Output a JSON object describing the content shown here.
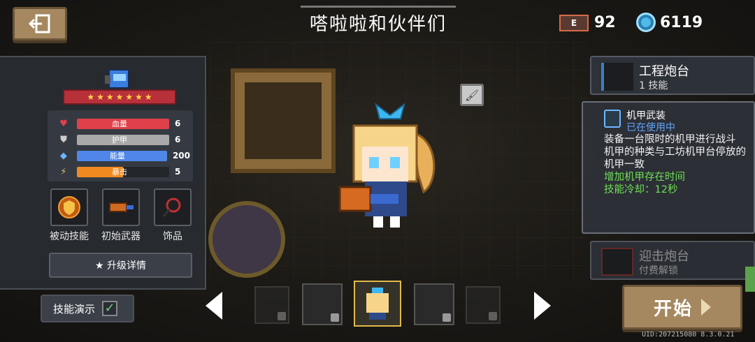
{
  "header": {
    "title": "嗒啦啦和伙伴们",
    "gem_label": "E",
    "gem_count": "92",
    "coin_count": "6119"
  },
  "hero": {
    "stars": 7,
    "stats": [
      {
        "name": "血量",
        "value": "6",
        "fill": 1.0,
        "color": "#e0404a",
        "icon": "heart-icon"
      },
      {
        "name": "护甲",
        "value": "6",
        "fill": 1.0,
        "color": "#a9a9a9",
        "icon": "shield-icon"
      },
      {
        "name": "能量",
        "value": "200",
        "fill": 1.0,
        "color": "#4f86e8",
        "icon": "energy-crystal-icon"
      },
      {
        "name": "暴击",
        "value": "5",
        "fill": 0.5,
        "color": "#f08a20",
        "icon": "crit-icon"
      }
    ],
    "slots": [
      {
        "label": "被动技能",
        "icon": "passive-skill-icon"
      },
      {
        "label": "初始武器",
        "icon": "starting-weapon-icon"
      },
      {
        "label": "饰品",
        "icon": "accessory-icon"
      }
    ],
    "upgrade_label": "★ 升级详情",
    "demo_label": "技能演示",
    "demo_checked": true
  },
  "skills": {
    "current": {
      "name": "工程炮台",
      "count": "1 技能"
    },
    "tooltip": {
      "title": "机甲武装",
      "status": "已在使用中",
      "lines": [
        "装备一台限时的机甲进行战斗",
        "机甲的种类与工坊机甲台停放的机甲一致"
      ],
      "bonus1": "增加机甲存在时间",
      "bonus2": "技能冷却：12秒"
    },
    "locked": {
      "name": "迎击炮台",
      "count": "付费解锁"
    }
  },
  "start_label": "开始",
  "uid": "UID:207215080 8.3.0.21"
}
